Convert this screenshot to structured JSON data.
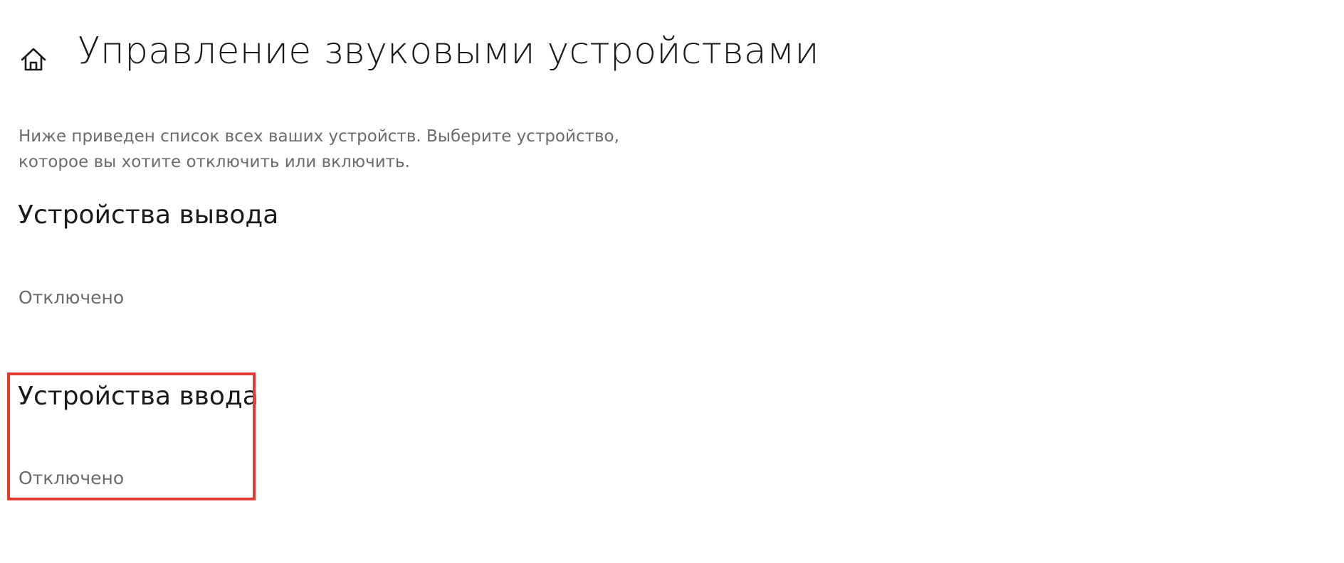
{
  "header": {
    "home_icon": "home-icon",
    "title": "Управление звуковыми устройствами"
  },
  "description": {
    "line1": "Ниже приведен список всех ваших устройств. Выберите устройство,",
    "line2": "которое вы хотите отключить или включить."
  },
  "output_devices": {
    "heading": "Устройства вывода",
    "status": "Отключено"
  },
  "input_devices": {
    "heading": "Устройства ввода",
    "status": "Отключено"
  },
  "colors": {
    "highlight": "#e03c33",
    "title_text": "#1a1a1a",
    "secondary_text": "#6b6b6b"
  }
}
